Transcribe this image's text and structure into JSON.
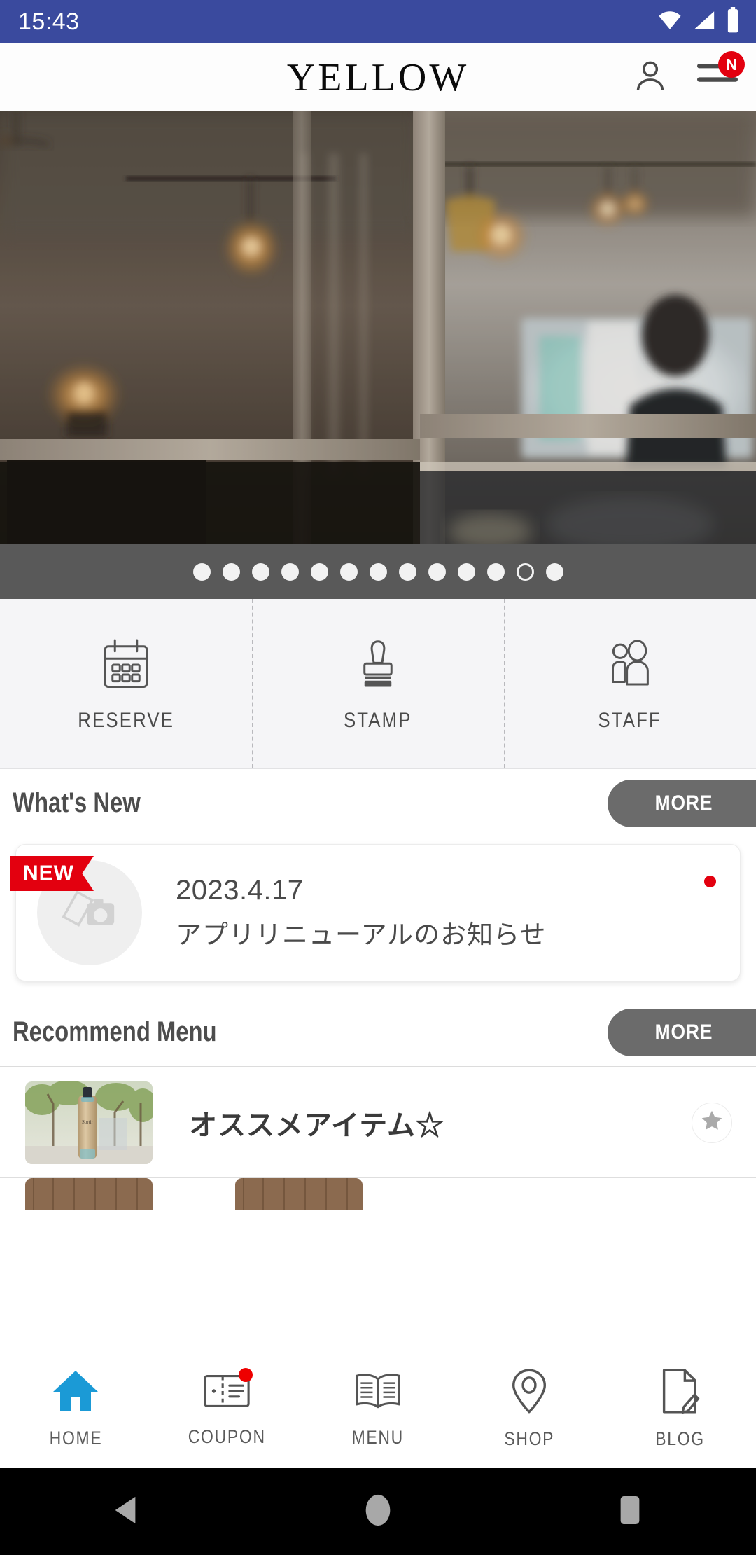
{
  "status_bar": {
    "time": "15:43",
    "background": "#3a4a9e",
    "icons": [
      "wifi-icon",
      "signal-icon",
      "battery-icon"
    ]
  },
  "header": {
    "logo": "YELLOW",
    "account_icon": "person-icon",
    "menu_icon": "hamburger-menu-icon",
    "menu_badge": "N",
    "badge_color": "#e3000f"
  },
  "hero": {
    "alt": "salon interior seen through wooden framed glass door",
    "carousel": {
      "total_dots": 13,
      "active_index": 11
    }
  },
  "quick_actions": [
    {
      "label": "RESERVE",
      "icon": "calendar-icon"
    },
    {
      "label": "STAMP",
      "icon": "stamp-icon"
    },
    {
      "label": "STAFF",
      "icon": "people-icon"
    }
  ],
  "whats_new": {
    "title": "What's New",
    "more_label": "MORE",
    "items": [
      {
        "badge": "NEW",
        "date": "2023.4.17",
        "title": "アプリリニューアルのお知らせ",
        "thumb_icon": "photo-placeholder-icon",
        "unread": true
      }
    ]
  },
  "recommend_menu": {
    "title": "Recommend Menu",
    "more_label": "MORE",
    "items": [
      {
        "title": "オススメアイテム☆",
        "thumb_alt": "hair oil bottle outdoors with green trees",
        "star_icon": "star-icon"
      }
    ]
  },
  "bottom_nav": [
    {
      "label": "HOME",
      "icon": "home-icon",
      "active": true,
      "badge": false
    },
    {
      "label": "COUPON",
      "icon": "coupon-icon",
      "active": false,
      "badge": true
    },
    {
      "label": "MENU",
      "icon": "book-icon",
      "active": false,
      "badge": false
    },
    {
      "label": "SHOP",
      "icon": "location-pin-icon",
      "active": false,
      "badge": false
    },
    {
      "label": "BLOG",
      "icon": "document-pen-icon",
      "active": false,
      "badge": false
    }
  ],
  "android_nav": {
    "back": "back-triangle-icon",
    "home": "home-circle-icon",
    "recents": "recents-square-icon"
  },
  "colors": {
    "status_bar": "#3a4a9e",
    "accent_red": "#e3000f",
    "active_nav": "#1b9ad6",
    "more_button": "#6b6b6b",
    "dots_bar": "#595959"
  }
}
